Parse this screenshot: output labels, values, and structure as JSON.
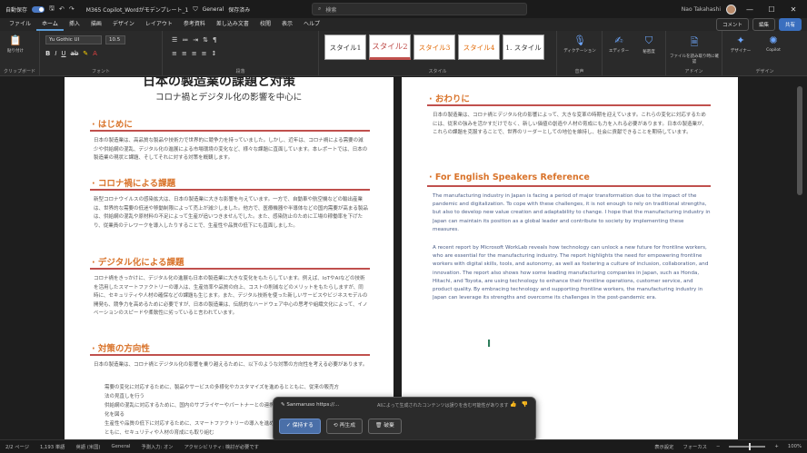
{
  "titlebar": {
    "autosave": "自動保存",
    "autosave_state": "オン",
    "doc_title": "M365 Copilot_Wordがモデンプレート_1",
    "label": "General",
    "saved": "保存済み",
    "search_placeholder": "検索",
    "user": "Nao Takahashi"
  },
  "menu": {
    "items": [
      "ファイル",
      "ホーム",
      "挿入",
      "描画",
      "デザイン",
      "レイアウト",
      "参考資料",
      "差し込み文書",
      "校閲",
      "表示",
      "ヘルプ"
    ],
    "active_index": 1,
    "comment": "コメント",
    "editing": "編集",
    "share": "共有"
  },
  "ribbon": {
    "font_name": "Yu Gothic UI",
    "font_size": "10.5",
    "clipboard": "クリップボード",
    "font_group": "フォント",
    "paragraph_group": "段落",
    "styles_group": "スタイル",
    "paste": "貼り付け",
    "styles": [
      "スタイル1",
      "スタイル2",
      "スタイル3",
      "スタイル4",
      "1. スタイル"
    ],
    "dictate": "ディクテーション",
    "editor": "エディター",
    "sensitivity": "秘密度",
    "add_ins": "アドイン",
    "file_convert": "ファイルを読み取り時に確認",
    "designer": "デザイナー",
    "copilot": "Copilot",
    "voice_group": "音声",
    "designer_group": "デザイン"
  },
  "left_page": {
    "title": "日本の製造業の課題と対策",
    "subtitle": "コロナ禍とデジタル化の影響を中心に",
    "sections": [
      {
        "heading": "はじめに",
        "text": "日本の製造業は、高品質な製品や技術力で世界的に競争力を持っていました。しかし、近年は、コロナ禍による需要の減少や供給網の混乱、デジタル化の進展による市場環境の変化など、様々な課題に直面しています。本レポートでは、日本の製造業の現状と課題、そしてそれに対する対策を概観します。"
      },
      {
        "heading": "コロナ禍による課題",
        "text": "新型コロナウイルスの感染拡大は、日本の製造業に大きな影響を与えています。一方で、自動車や航空機などの輸出産業は、世界的な需要の低迷や移動制限によって売上が減少しました。他方で、医療機器や半導体などの国内需要が高まる製品は、供給網の混乱や原材料の不足によって生産が追いつきませんでした。また、感染防止のために工場の稼働率を下げたり、従業員のテレワークを導入したりすることで、生産性や品質の低下にも直面しました。"
      },
      {
        "heading": "デジタル化による課題",
        "text": "コロナ禍をきっかけに、デジタル化の進展も日本の製造業に大きな変化をもたらしています。例えば、IoTやAIなどの技術を活用したスマートファクトリーの導入は、生産効率や品質の向上、コストの削減などのメリットをもたらしますが、同時に、セキュリティや人材の確保などの課題も生じます。また、デジタル技術を使った新しいサービスやビジネスモデルの開発も、競争力を高めるために必要ですが、日本の製造業は、伝統的なハードウェア中心の思考や組織文化によって、イノベーションのスピードや柔軟性に劣っていると言われています。"
      },
      {
        "heading": "対策の方向性",
        "text": "日本の製造業は、コロナ禍とデジタル化の影響を乗り越えるために、以下のような対策の方向性を考える必要があります。"
      }
    ],
    "bullets": [
      "需要の変化に対応するために、製品やサービスの多様化やカスタマイズを進めるとともに、従来の販売方法の見直しを行う",
      "供給網の混乱に対応するために、国内のサプライヤーやパートナーとの連携を強化し、在庫や調達の最適化を図る",
      "生産性や品質の低下に対応するために、スマートファクトリーの導入を進め、デジタル技術を活用するとともに、セキュリティや人材の育成にも取り組む"
    ]
  },
  "right_page": {
    "heading1": "おわりに",
    "text1": "日本の製造業は、コロナ禍とデジタル化の影響によって、大きな変革の時期を迎えています。これらの変化に対応するためには、従来の強みを活かすだけでなく、新しい価値の創造や人材の育成にも力を入れる必要があります。日本の製造業が、これらの課題を克服することで、世界のリーダーとしての地位を維持し、社会に貢献できることを期待しています。",
    "heading2": "For English Speakers Reference",
    "en_para1": "The manufacturing industry in Japan is facing a period of major transformation due to the impact of the pandemic and digitalization. To cope with these challenges, it is not enough to rely on traditional strengths, but also to develop new value creation and adaptability to change. I hope that the manufacturing industry in Japan can maintain its position as a global leader and contribute to society by implementing these measures.",
    "en_para2": "A recent report by Microsoft WorkLab reveals how technology can unlock a new future for frontline workers, who are essential for the manufacturing industry. The report highlights the need for empowering frontline workers with digital skills, tools, and autonomy, as well as fostering a culture of inclusion, collaboration, and innovation. The report also shows how some leading manufacturing companies in Japan, such as Honda, Hitachi, and Toyota, are using technology to enhance their frontline operations, customer service, and product quality. By embracing technology and supporting frontline workers, the manufacturing industry in Japan can leverage its strengths and overcome its challenges in the post-pandemic era."
  },
  "copilot": {
    "source": "Sanmaruso https://...",
    "note": "AIによって生成されたコンテンツは誤りを含む可能性があります",
    "keep": "保持する",
    "regenerate": "再生成",
    "discard": "破棄"
  },
  "status": {
    "page": "2/2 ページ",
    "words": "1,193 単語",
    "lang": "英語 (米国)",
    "sensitivity": "General",
    "predict": "予測入力: オン",
    "accessibility": "アクセシビリティ: 検討が必要です",
    "display": "表示設定",
    "focus": "フォーカス",
    "zoom": "100%"
  }
}
